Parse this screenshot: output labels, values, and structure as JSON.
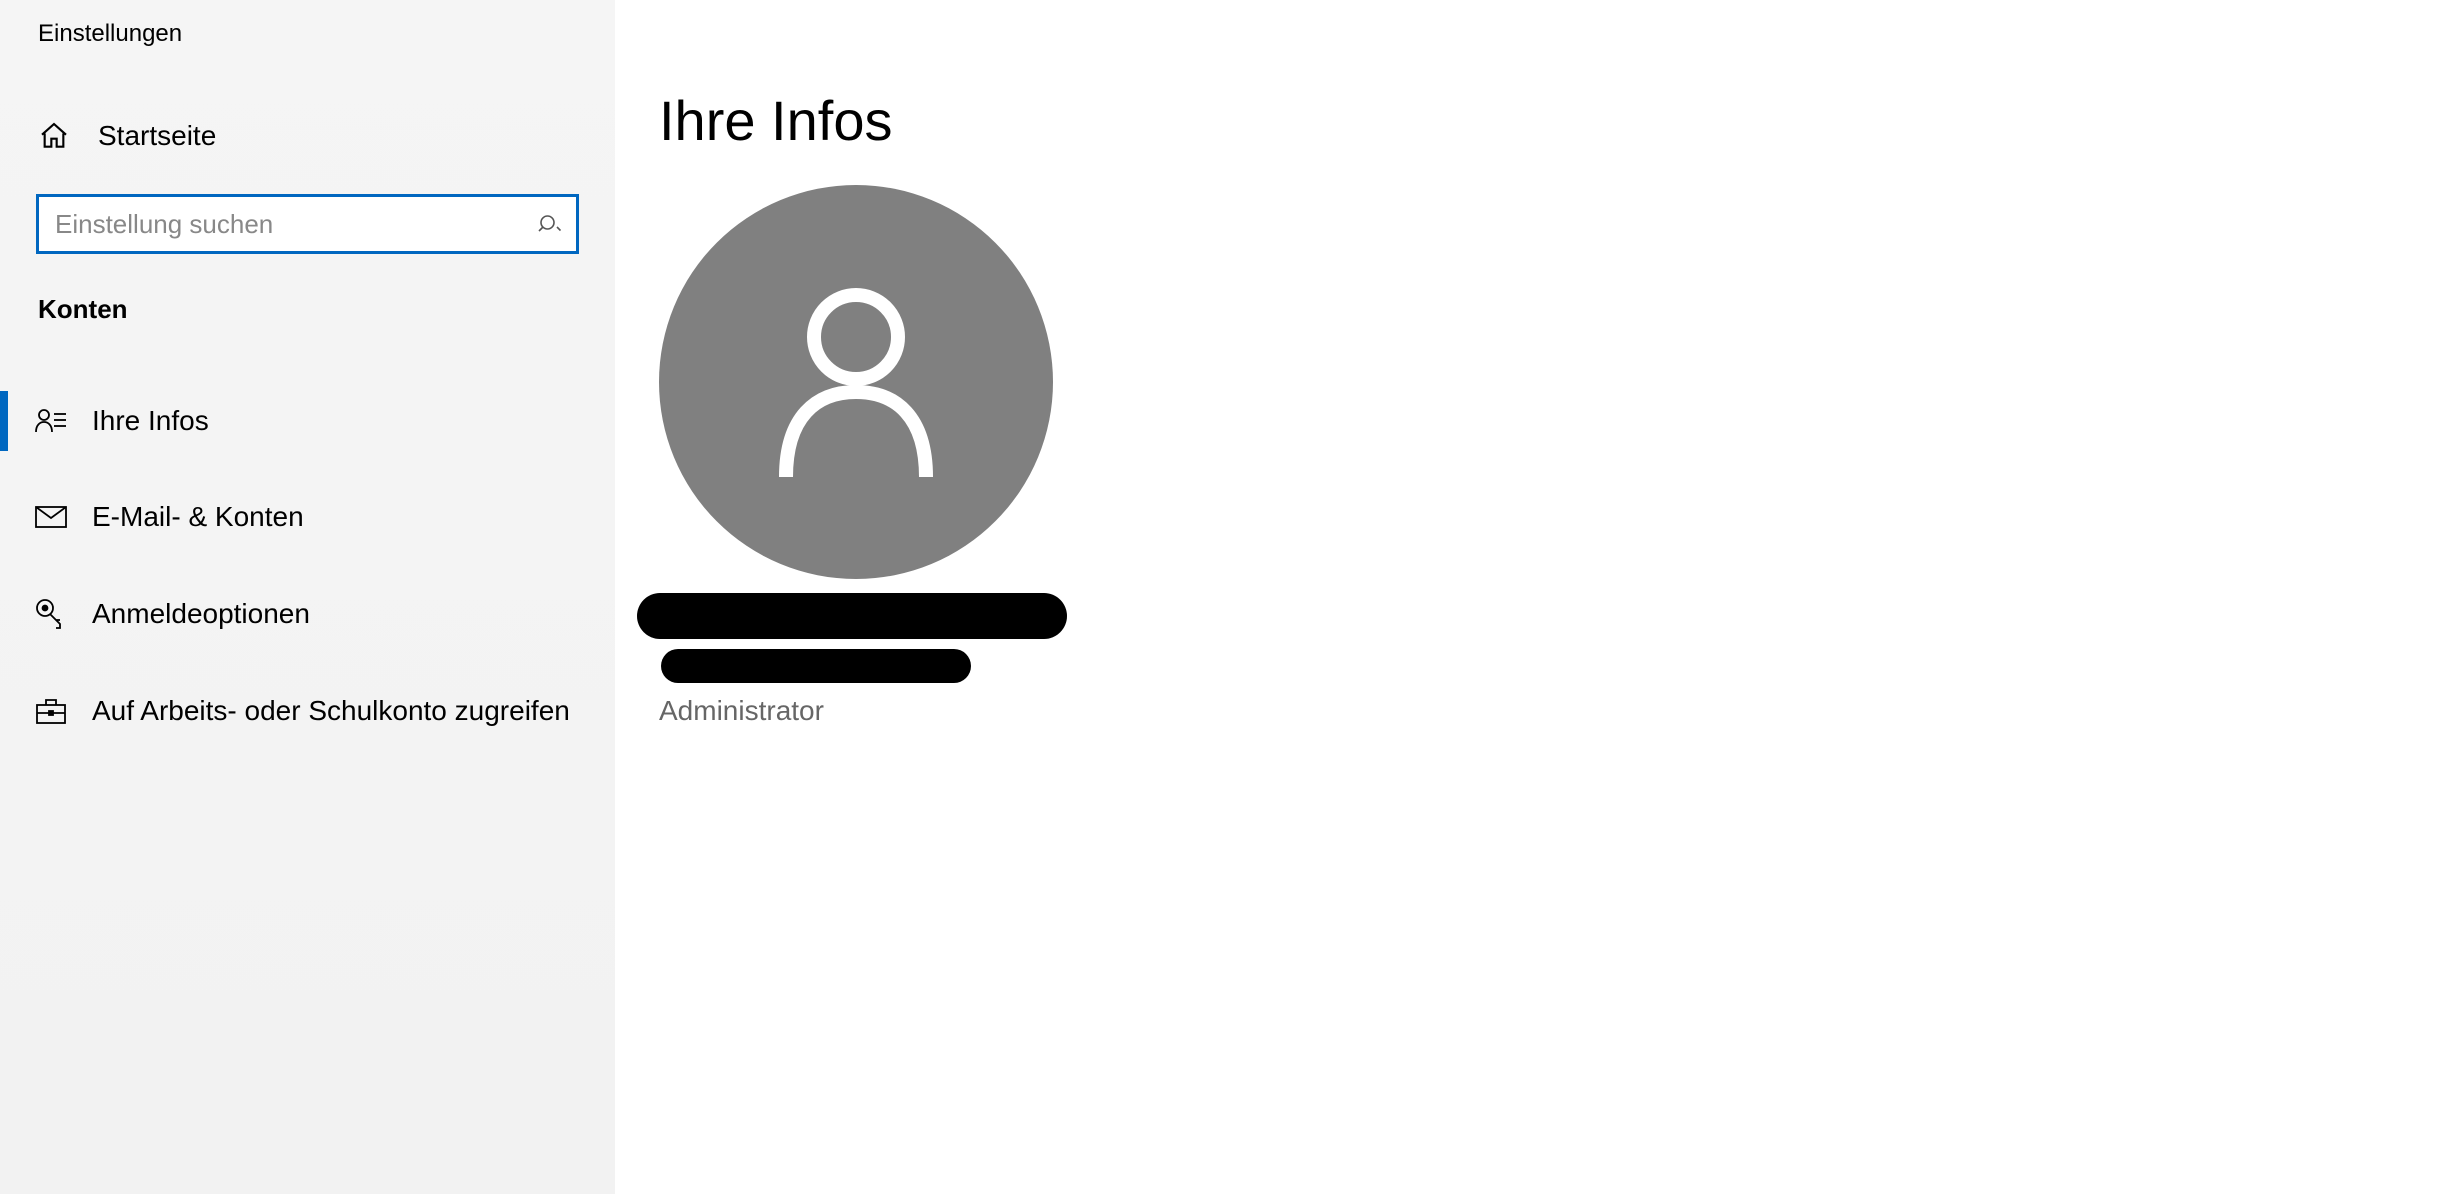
{
  "app": {
    "title": "Einstellungen"
  },
  "sidebar": {
    "home_label": "Startseite",
    "search_placeholder": "Einstellung suchen",
    "category_label": "Konten",
    "items": [
      {
        "label": "Ihre Infos",
        "selected": true
      },
      {
        "label": "E-Mail- & Konten",
        "selected": false
      },
      {
        "label": "Anmeldeoptionen",
        "selected": false
      },
      {
        "label": "Auf Arbeits- oder Schulkonto zugreifen",
        "selected": false
      }
    ]
  },
  "main": {
    "page_title": "Ihre Infos",
    "role": "Administrator"
  }
}
